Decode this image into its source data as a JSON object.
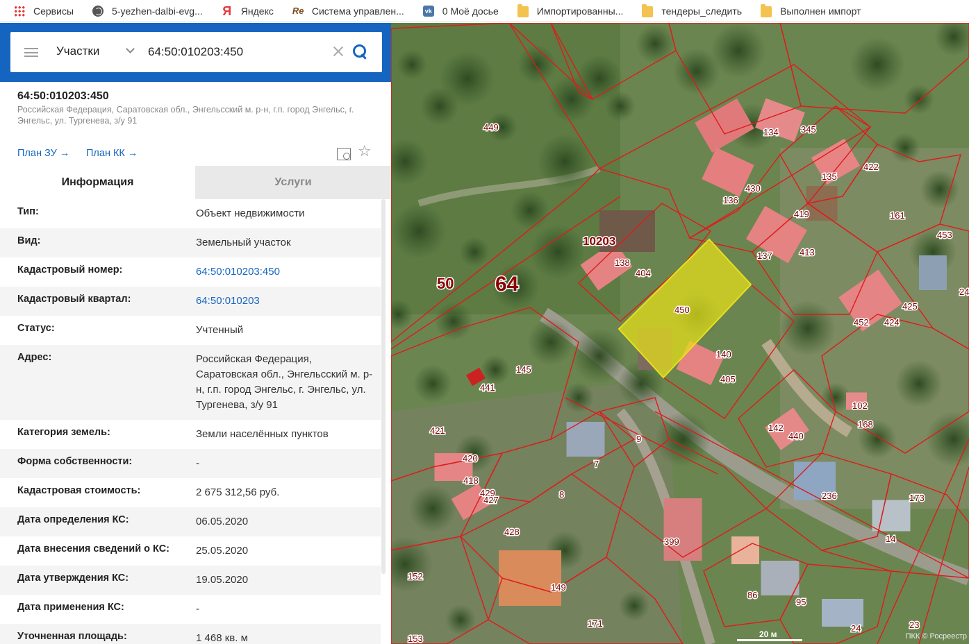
{
  "bookmarks": [
    {
      "label": "Сервисы",
      "icon": "apps-icon"
    },
    {
      "label": "5-yezhen-dalbi-evg...",
      "icon": "globe-icon"
    },
    {
      "label": "Яндекс",
      "icon": "yandex-icon"
    },
    {
      "label": "Система управлен...",
      "icon": "re-icon"
    },
    {
      "label": "0 Моё досье",
      "icon": "vk-icon"
    },
    {
      "label": "Импортированны...",
      "icon": "folder-icon"
    },
    {
      "label": "тендеры_следить",
      "icon": "folder-icon"
    },
    {
      "label": "Выполнен импорт",
      "icon": "folder-icon"
    }
  ],
  "search": {
    "type": "Участки",
    "value": "64:50:010203:450"
  },
  "object": {
    "title": "64:50:010203:450",
    "address": "Российская Федерация, Саратовская обл., Энгельсский м. р-н, г.п. город Энгельс, г. Энгельс, ул. Тургенева, з/у 91",
    "plan_zu": "План ЗУ →",
    "plan_kk": "План КК →"
  },
  "tabs": {
    "info": "Информация",
    "services": "Услуги"
  },
  "info": [
    {
      "label": "Тип:",
      "value": "Объект недвижимости",
      "link": false
    },
    {
      "label": "Вид:",
      "value": "Земельный участок",
      "link": false
    },
    {
      "label": "Кадастровый номер:",
      "value": "64:50:010203:450",
      "link": true
    },
    {
      "label": "Кадастровый квартал:",
      "value": "64:50:010203",
      "link": true
    },
    {
      "label": "Статус:",
      "value": "Учтенный",
      "link": false
    },
    {
      "label": "Адрес:",
      "value": "Российская Федерация, Саратовская обл., Энгельсский м. р-н, г.п. город Энгельс, г. Энгельс, ул. Тургенева, з/у 91",
      "link": false
    },
    {
      "label": "Категория земель:",
      "value": "Земли населённых пунктов",
      "link": false
    },
    {
      "label": "Форма собственности:",
      "value": "-",
      "link": false
    },
    {
      "label": "Кадастровая стоимость:",
      "value": "2 675 312,56 руб.",
      "link": false
    },
    {
      "label": "Дата определения КС:",
      "value": "06.05.2020",
      "link": false
    },
    {
      "label": "Дата внесения сведений о КС:",
      "value": "25.05.2020",
      "link": false
    },
    {
      "label": "Дата утверждения КС:",
      "value": "19.05.2020",
      "link": false
    },
    {
      "label": "Дата применения КС:",
      "value": "-",
      "link": false
    },
    {
      "label": "Уточненная площадь:",
      "value": "1 468 кв. м",
      "link": false
    }
  ],
  "map": {
    "selected_label": "450",
    "quarter_label": "10203",
    "district_label": "50",
    "region_label": "64",
    "scale": "20 м",
    "copyright": "ПКК © Росреестр",
    "parcels": [
      "449",
      "134",
      "345",
      "422",
      "135",
      "430",
      "136",
      "161",
      "453",
      "419",
      "137",
      "413",
      "138",
      "404",
      "425",
      "24",
      "452",
      "424",
      "140",
      "405",
      "145",
      "441",
      "102",
      "168",
      "142",
      "440",
      "421",
      "420",
      "418",
      "429",
      "427",
      "9",
      "7",
      "8",
      "236",
      "173",
      "14",
      "428",
      "399",
      "149",
      "152",
      "86",
      "95",
      "171",
      "153",
      "24",
      "23"
    ]
  }
}
